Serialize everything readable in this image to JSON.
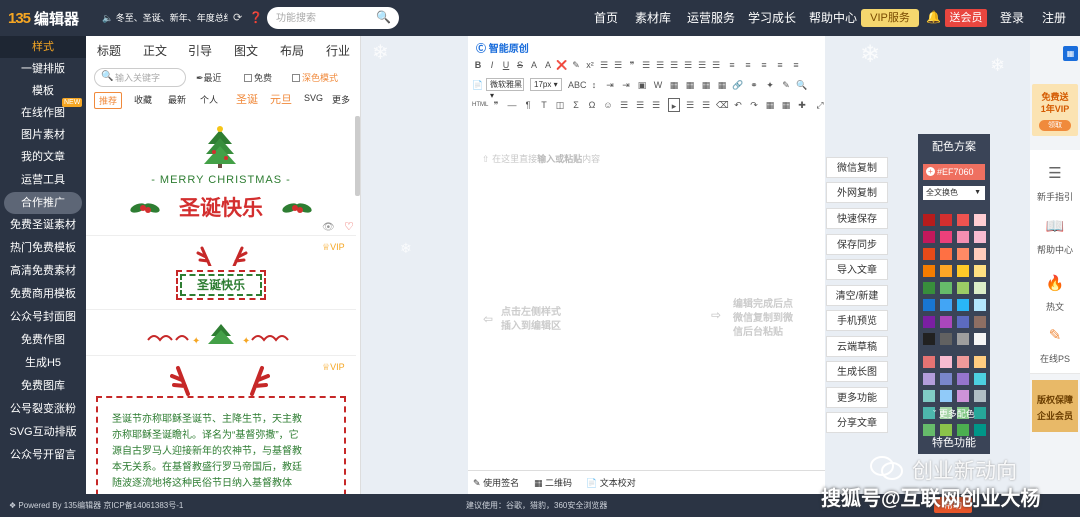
{
  "header": {
    "logo_mark": "135",
    "logo_text": "编辑器",
    "notice": "冬至、圣诞、新年、年度总结模板",
    "search_placeholder": "功能搜索",
    "nav": [
      "首页",
      "素材库",
      "运营服务",
      "学习成长",
      "帮助中心"
    ],
    "vip": "VIP服务",
    "member": "送会员",
    "login": "登录",
    "register": "注册"
  },
  "sidebar": {
    "items": [
      "样式",
      "一键排版",
      "模板",
      "在线作图",
      "图片素材",
      "我的文章",
      "运营工具",
      "合作推广",
      "免费圣诞素材",
      "热门免费模板",
      "高清免费素材",
      "免费商用模板",
      "公众号封面图",
      "免费作图",
      "生成H5",
      "免费图库",
      "公号裂变涨粉",
      "SVG互动排版",
      "公众号开留言"
    ],
    "new_badge": "NEW"
  },
  "template_panel": {
    "tabs": [
      "标题",
      "正文",
      "引导",
      "图文",
      "布局",
      "行业"
    ],
    "search_placeholder": "输入关键字",
    "recent": "最近",
    "free": "免费",
    "dark_mode": "深色模式",
    "filters": [
      "推荐",
      "收藏",
      "最新",
      "个人",
      "圣诞",
      "元旦",
      "SVG",
      "更多"
    ],
    "card1": {
      "subtitle": "- MERRY CHRISTMAS -",
      "title": "圣诞快乐"
    },
    "card2": {
      "vip": "VIP",
      "title": "圣诞快乐"
    },
    "card3": {
      "vip": "VIP",
      "lines": [
        "圣诞节亦称耶稣圣诞节、主降生节，天主教",
        "亦称耶稣圣诞瞻礼。译名为“基督弥撒”，它",
        "源自古罗马人迎接新年的农神节，与基督教",
        "本无关系。在基督教盛行罗马帝国后，教廷",
        "随波逐流地将这种民俗节日纳入基督教体"
      ]
    }
  },
  "editor": {
    "brand": "智能原创",
    "font_family": "微软雅黑",
    "font_size": "17px",
    "placeholder_pre": "在这里直接",
    "placeholder_bold": "输入或粘贴",
    "placeholder_post": "内容",
    "hint_left": [
      "点击左侧样式",
      "插入到编辑区"
    ],
    "hint_right": [
      "编辑完成后点",
      "微信复制到微",
      "信后台粘贴"
    ],
    "footer_buttons": [
      "使用签名",
      "二维码",
      "文本校对"
    ]
  },
  "functions": [
    "微信复制",
    "外网复制",
    "快速保存",
    "保存同步",
    "导入文章",
    "清空/新建",
    "手机预览",
    "云端草稿",
    "生成长图",
    "更多功能",
    "分享文章"
  ],
  "color_panel": {
    "title": "配色方案",
    "current": "#EF7060",
    "scope": "全文换色",
    "more": "更多配色",
    "feature": "特色功能",
    "swatches": [
      [
        "#b71c1c",
        "#d32f2f",
        "#ef5350",
        "#ffcdd2"
      ],
      [
        "#c2185b",
        "#ec407a",
        "#f48fb1",
        "#f8bbd0"
      ],
      [
        "#e64a19",
        "#ff7043",
        "#ff8a65",
        "#ffccbc"
      ],
      [
        "#f57c00",
        "#ffa726",
        "#ffca28",
        "#ffe082"
      ],
      [
        "#388e3c",
        "#66bb6a",
        "#9ccc65",
        "#dcedc8"
      ],
      [
        "#1976d2",
        "#42a5f5",
        "#29b6f6",
        "#b3e5fc"
      ],
      [
        "#7b1fa2",
        "#ab47bc",
        "#5c6bc0",
        "#8d6e63"
      ],
      [
        "#212121",
        "#616161",
        "#9e9e9e",
        "#f5f5f5"
      ],
      [
        "#e57373",
        "#f8bbd0",
        "#ef9a9a",
        "#ffcc80"
      ],
      [
        "#b39ddb",
        "#7986cb",
        "#9575cd",
        "#4dd0e1"
      ],
      [
        "#80cbc4",
        "#90caf9",
        "#ce93d8",
        "#b0bec5"
      ],
      [
        "#4db6ac",
        "#a5d6a7",
        "#81c784",
        "#26a69a"
      ],
      [
        "#66bb6a",
        "#8bc34a",
        "#4caf50",
        "#009688"
      ]
    ]
  },
  "right_bar": {
    "ad_vip": [
      "免费送",
      "1年VIP"
    ],
    "ad_vip_btn": "领取",
    "tools": [
      "新手指引",
      "帮助中心",
      "热文",
      "在线PS"
    ],
    "ad_ent": [
      "版权保障",
      "企业会员"
    ]
  },
  "footer": {
    "left": "Powered By 135编辑器  京ICP备14061383号-1",
    "mid": "建议使用：谷歌，猎豹，360安全浏览器",
    "help": "帮助"
  },
  "watermark": {
    "line1": "创业新动向",
    "line2": "搜狐号@互联网创业大杨"
  },
  "colors": {
    "topbar": "#2b3444",
    "accent": "#f08a3c",
    "christmas_red": "#d32f2f",
    "christmas_green": "#2e7d32"
  }
}
